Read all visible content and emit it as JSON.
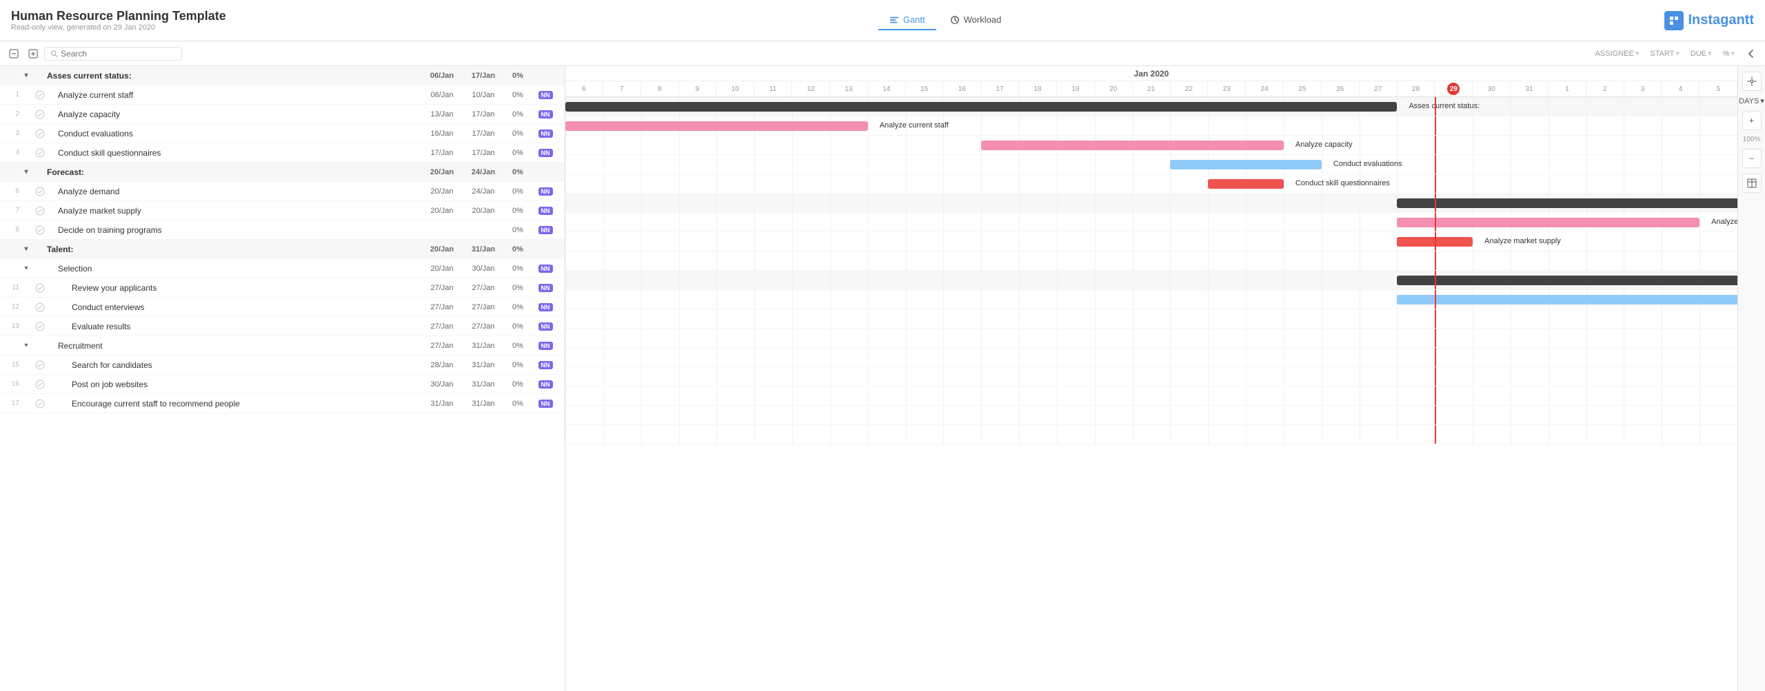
{
  "app": {
    "title": "Human Resource Planning Template",
    "subtitle": "Read-only view, generated on 29 Jan 2020",
    "logo": "Instagantt"
  },
  "nav": {
    "gantt_label": "Gantt",
    "workload_label": "Workload"
  },
  "toolbar": {
    "search_placeholder": "Search",
    "assignee_col": "ASSIGNEE",
    "start_col": "START",
    "due_col": "DUE",
    "pct_col": "%",
    "days_label": "DAYS"
  },
  "gantt_header": {
    "month": "Jan 2020",
    "days": [
      6,
      7,
      8,
      9,
      10,
      11,
      12,
      13,
      14,
      15,
      16,
      17,
      18,
      19,
      20,
      21,
      22,
      23,
      24,
      25,
      26,
      27,
      28,
      29,
      30,
      31,
      1,
      2,
      3,
      4,
      5
    ],
    "today": 29
  },
  "tasks": [
    {
      "id": null,
      "num": "",
      "level": 0,
      "type": "group",
      "name": "Asses current status:",
      "start": "06/Jan",
      "due": "17/Jan",
      "pct": "0%",
      "assign": ""
    },
    {
      "id": 1,
      "num": "1",
      "level": 1,
      "type": "task",
      "name": "Analyze current staff",
      "start": "06/Jan",
      "due": "10/Jan",
      "pct": "0%",
      "assign": "NN"
    },
    {
      "id": 2,
      "num": "2",
      "level": 1,
      "type": "task",
      "name": "Analyze capacity",
      "start": "13/Jan",
      "due": "17/Jan",
      "pct": "0%",
      "assign": "NN"
    },
    {
      "id": 3,
      "num": "3",
      "level": 1,
      "type": "task",
      "name": "Conduct evaluations",
      "start": "16/Jan",
      "due": "17/Jan",
      "pct": "0%",
      "assign": "NN"
    },
    {
      "id": 4,
      "num": "4",
      "level": 1,
      "type": "task",
      "name": "Conduct skill questionnaires",
      "start": "17/Jan",
      "due": "17/Jan",
      "pct": "0%",
      "assign": "NN"
    },
    {
      "id": null,
      "num": "",
      "level": 0,
      "type": "group",
      "name": "Forecast:",
      "start": "20/Jan",
      "due": "24/Jan",
      "pct": "0%",
      "assign": ""
    },
    {
      "id": 6,
      "num": "6",
      "level": 1,
      "type": "task",
      "name": "Analyze demand",
      "start": "20/Jan",
      "due": "24/Jan",
      "pct": "0%",
      "assign": "NN"
    },
    {
      "id": 7,
      "num": "7",
      "level": 1,
      "type": "task",
      "name": "Analyze market supply",
      "start": "20/Jan",
      "due": "20/Jan",
      "pct": "0%",
      "assign": "NN"
    },
    {
      "id": 8,
      "num": "8",
      "level": 1,
      "type": "task",
      "name": "Decide on training programs",
      "start": "",
      "due": "",
      "pct": "0%",
      "assign": "NN"
    },
    {
      "id": null,
      "num": "",
      "level": 0,
      "type": "group",
      "name": "Talent:",
      "start": "20/Jan",
      "due": "31/Jan",
      "pct": "0%",
      "assign": ""
    },
    {
      "id": null,
      "num": "",
      "level": 1,
      "type": "subgroup",
      "name": "Selection",
      "start": "20/Jan",
      "due": "30/Jan",
      "pct": "0%",
      "assign": "NN"
    },
    {
      "id": 11,
      "num": "11",
      "level": 2,
      "type": "task",
      "name": "Review your applicants",
      "start": "27/Jan",
      "due": "27/Jan",
      "pct": "0%",
      "assign": "NN"
    },
    {
      "id": 12,
      "num": "12",
      "level": 2,
      "type": "task",
      "name": "Conduct enterviews",
      "start": "27/Jan",
      "due": "27/Jan",
      "pct": "0%",
      "assign": "NN"
    },
    {
      "id": 13,
      "num": "13",
      "level": 2,
      "type": "task",
      "name": "Evaluate results",
      "start": "27/Jan",
      "due": "27/Jan",
      "pct": "0%",
      "assign": "NN"
    },
    {
      "id": null,
      "num": "",
      "level": 1,
      "type": "subgroup",
      "name": "Recruitment",
      "start": "27/Jan",
      "due": "31/Jan",
      "pct": "0%",
      "assign": "NN"
    },
    {
      "id": 15,
      "num": "15",
      "level": 2,
      "type": "task",
      "name": "Search for candidates",
      "start": "28/Jan",
      "due": "31/Jan",
      "pct": "0%",
      "assign": "NN"
    },
    {
      "id": 16,
      "num": "16",
      "level": 2,
      "type": "task",
      "name": "Post on job websites",
      "start": "30/Jan",
      "due": "31/Jan",
      "pct": "0%",
      "assign": "NN"
    },
    {
      "id": 17,
      "num": "17",
      "level": 2,
      "type": "task",
      "name": "Encourage current staff to recommend people",
      "start": "31/Jan",
      "due": "31/Jan",
      "pct": "0%",
      "assign": "NN"
    }
  ],
  "gantt_bars": [
    {
      "row": 0,
      "label": "Asses current status:",
      "type": "dark",
      "left_pct": 0,
      "width_pct": 22
    },
    {
      "row": 1,
      "label": "Analyze current staff",
      "type": "pink",
      "left_pct": 0,
      "width_pct": 8
    },
    {
      "row": 2,
      "label": "Analyze capacity",
      "type": "pink",
      "left_pct": 11,
      "width_pct": 8
    },
    {
      "row": 3,
      "label": "Conduct evaluations",
      "type": "blue",
      "left_pct": 16,
      "width_pct": 4
    },
    {
      "row": 4,
      "label": "Conduct skill questionnaires",
      "type": "red",
      "left_pct": 17,
      "width_pct": 2
    },
    {
      "row": 5,
      "label": "Forecast:",
      "type": "dark",
      "left_pct": 22,
      "width_pct": 12
    },
    {
      "row": 6,
      "label": "Analyze demand",
      "type": "pink",
      "left_pct": 22,
      "width_pct": 8
    },
    {
      "row": 7,
      "label": "Analyze market supply",
      "type": "red",
      "left_pct": 22,
      "width_pct": 2
    },
    {
      "row": 9,
      "label": "Talent:",
      "type": "dark",
      "left_pct": 22,
      "width_pct": 40
    },
    {
      "row": 10,
      "label": "Selection",
      "type": "blue",
      "left_pct": 22,
      "width_pct": 35
    },
    {
      "row": 11,
      "label": "Review your applicants",
      "type": "pink",
      "left_pct": 33,
      "width_pct": 2
    },
    {
      "row": 12,
      "label": "Conduct enterviews",
      "type": "pink",
      "left_pct": 33,
      "width_pct": 2
    },
    {
      "row": 13,
      "label": "Evaluate results",
      "type": "pink",
      "left_pct": 33,
      "width_pct": 2
    },
    {
      "row": 14,
      "label": "Recruitment",
      "type": "blue",
      "left_pct": 33,
      "width_pct": 14
    },
    {
      "row": 15,
      "label": "Search for candidates",
      "type": "blue",
      "left_pct": 35,
      "width_pct": 10
    },
    {
      "row": 16,
      "label": "Post on job websites",
      "type": "blue",
      "left_pct": 38,
      "width_pct": 5
    },
    {
      "row": 17,
      "label": "Encourage current staff to r",
      "type": "pink",
      "left_pct": 41,
      "width_pct": 2
    }
  ],
  "colors": {
    "accent": "#4a90e2",
    "today_line": "#e53935",
    "bar_pink": "#f48fb1",
    "bar_blue": "#90caf9",
    "bar_dark": "#424242",
    "bar_red": "#ef5350"
  }
}
